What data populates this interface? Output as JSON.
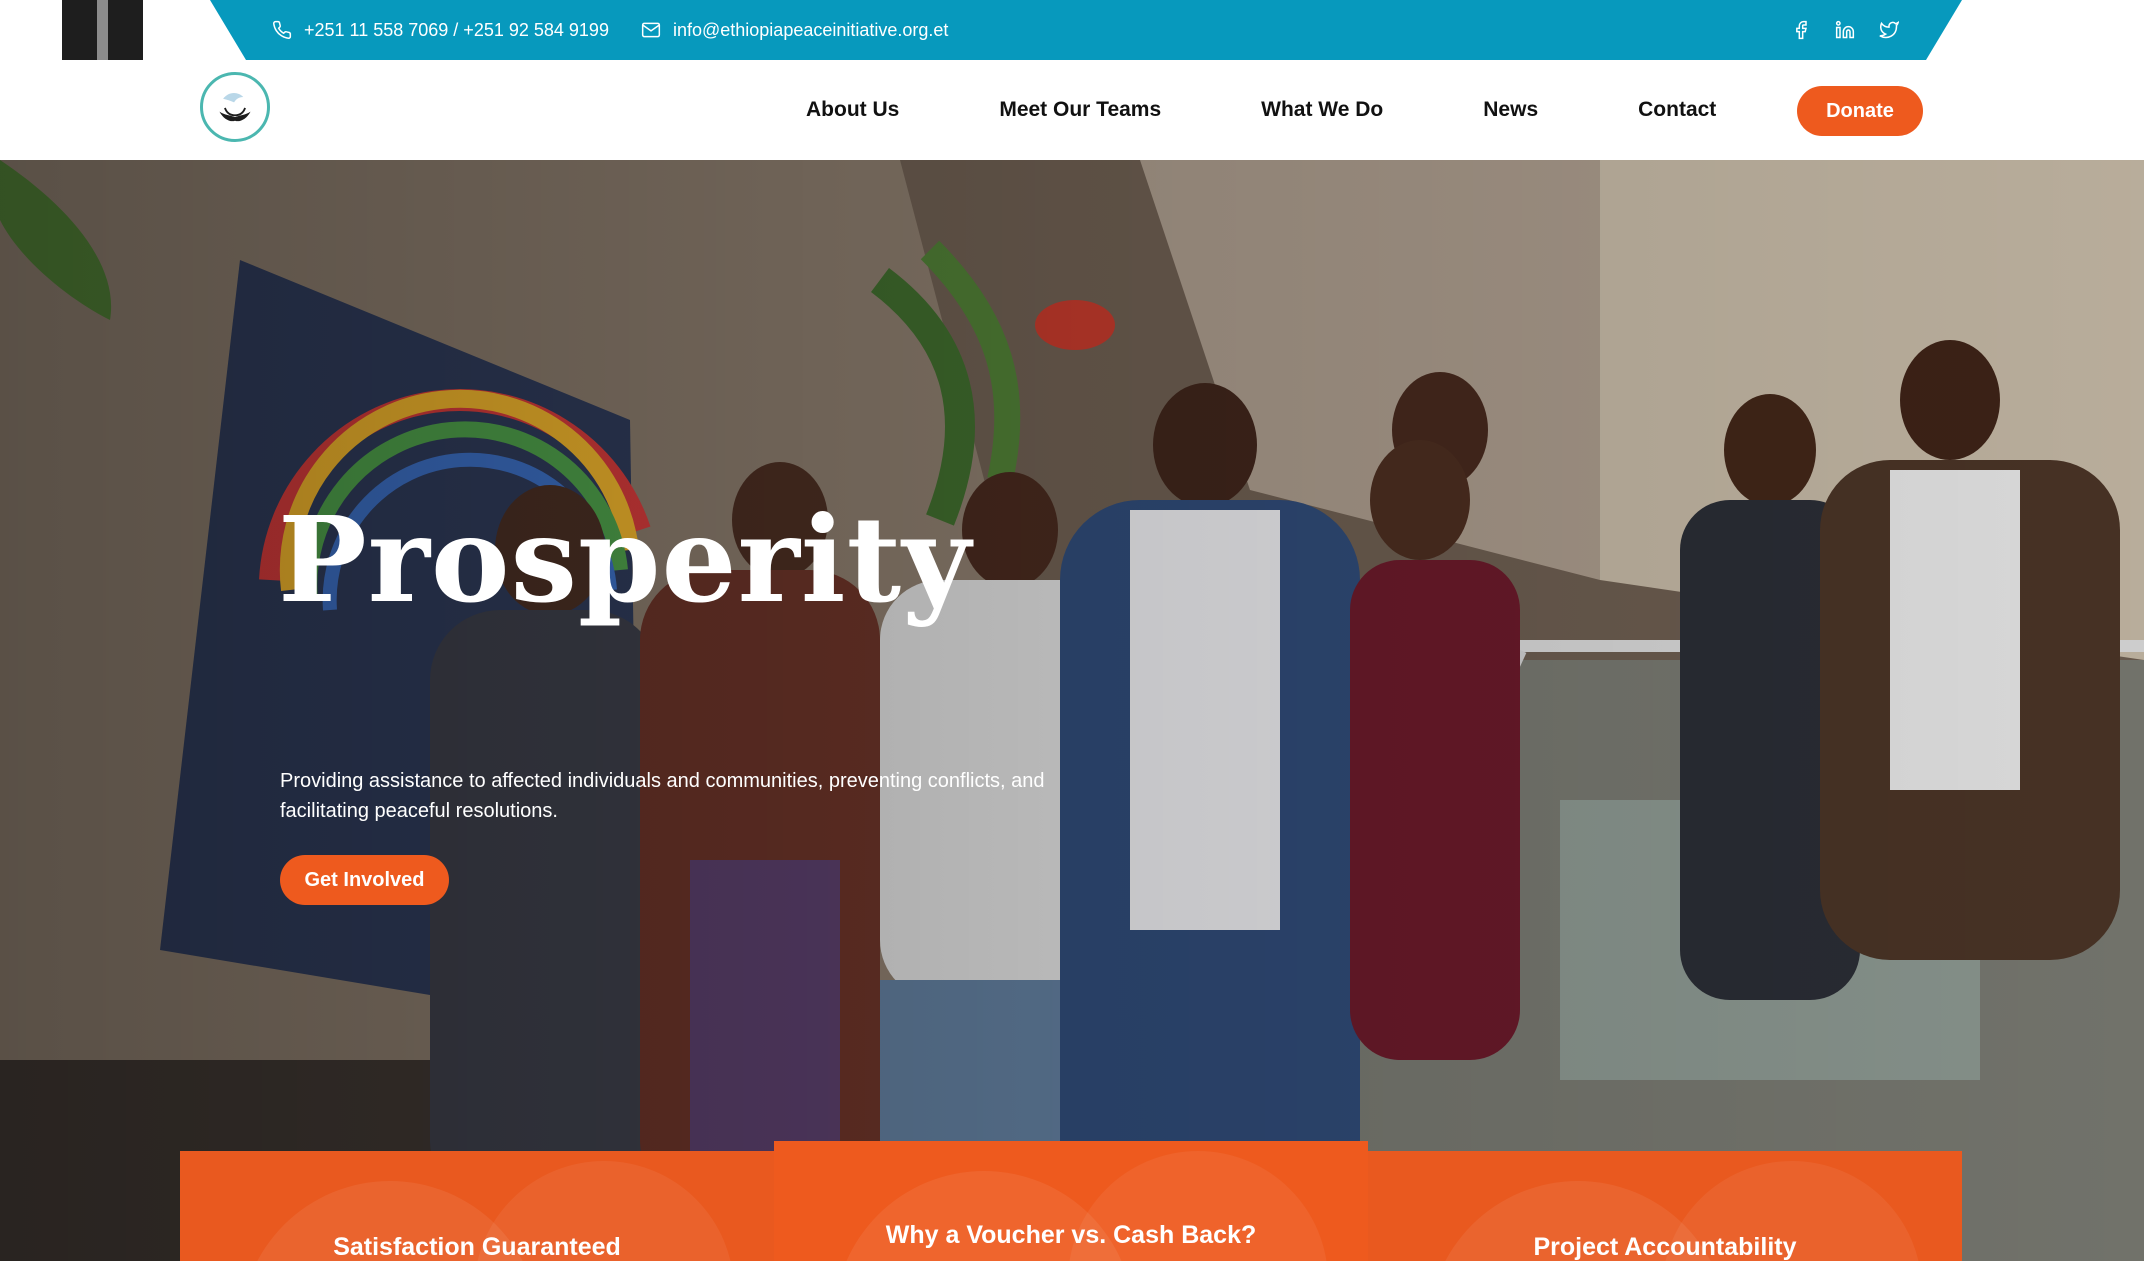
{
  "topbar": {
    "phone": "+251 11 558 7069 / +251 92 584 9199",
    "email": "info@ethiopiapeaceinitiative.org.et",
    "social": [
      "facebook-icon",
      "linkedin-icon",
      "twitter-icon"
    ]
  },
  "nav": {
    "items": [
      {
        "label": "About Us"
      },
      {
        "label": "Meet Our Teams"
      },
      {
        "label": "What We Do"
      },
      {
        "label": "News"
      },
      {
        "label": "Contact"
      }
    ],
    "donate_label": "Donate"
  },
  "hero": {
    "title": "Prosperity",
    "description": "Providing assistance to affected individuals and communities, preventing conflicts, and facilitating peaceful resolutions.",
    "cta_label": "Get Involved"
  },
  "cards": [
    {
      "title": "Satisfaction Guaranteed"
    },
    {
      "title": "Why a Voucher vs. Cash Back?"
    },
    {
      "title": "Project Accountability"
    }
  ],
  "colors": {
    "topbar": "#0799bd",
    "accent": "#ee5a1e",
    "dark": "#1e1e1e"
  }
}
